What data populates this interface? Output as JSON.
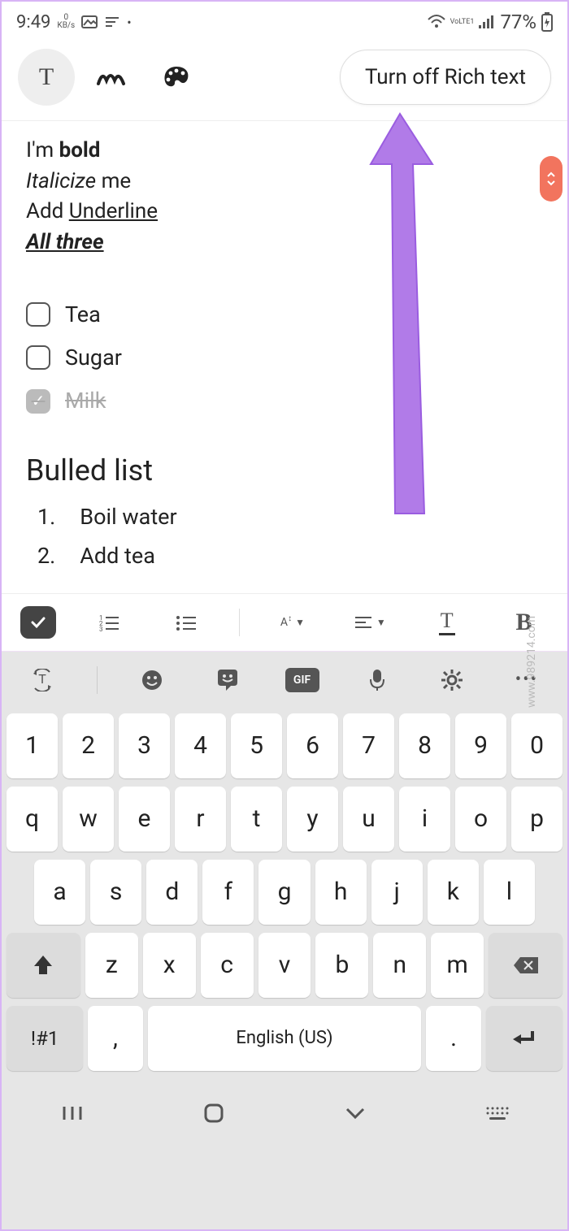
{
  "status": {
    "time": "9:49",
    "kbps_top": "0",
    "kbps_bottom": "KB/s",
    "network_label": "VoLTE1",
    "battery_percent": "77%"
  },
  "toolbar": {
    "rich_text_label": "Turn off Rich text"
  },
  "note": {
    "line1_prefix": "I'm ",
    "line1_bold": "bold",
    "line2_italic": "Italicize",
    "line2_rest": " me",
    "line3_prefix": "Add ",
    "line3_uline": "Underline ",
    "line4_all": "All three ",
    "checklist": [
      {
        "checked": false,
        "label": "Tea"
      },
      {
        "checked": false,
        "label": "Sugar"
      },
      {
        "checked": true,
        "label": "Milk"
      }
    ],
    "heading": "Bulled list",
    "ordered": [
      {
        "n": "1.",
        "text": "Boil water"
      },
      {
        "n": "2.",
        "text": "Add tea"
      }
    ]
  },
  "keyboard": {
    "gif": "GIF",
    "row1": [
      "1",
      "2",
      "3",
      "4",
      "5",
      "6",
      "7",
      "8",
      "9",
      "0"
    ],
    "row2": [
      "q",
      "w",
      "e",
      "r",
      "t",
      "y",
      "u",
      "i",
      "o",
      "p"
    ],
    "row3": [
      "a",
      "s",
      "d",
      "f",
      "g",
      "h",
      "j",
      "k",
      "l"
    ],
    "row4": [
      "z",
      "x",
      "c",
      "v",
      "b",
      "n",
      "m"
    ],
    "symbols": "!#1",
    "comma": ",",
    "space": "English (US)",
    "period": "."
  },
  "watermark": "www.989214.com"
}
